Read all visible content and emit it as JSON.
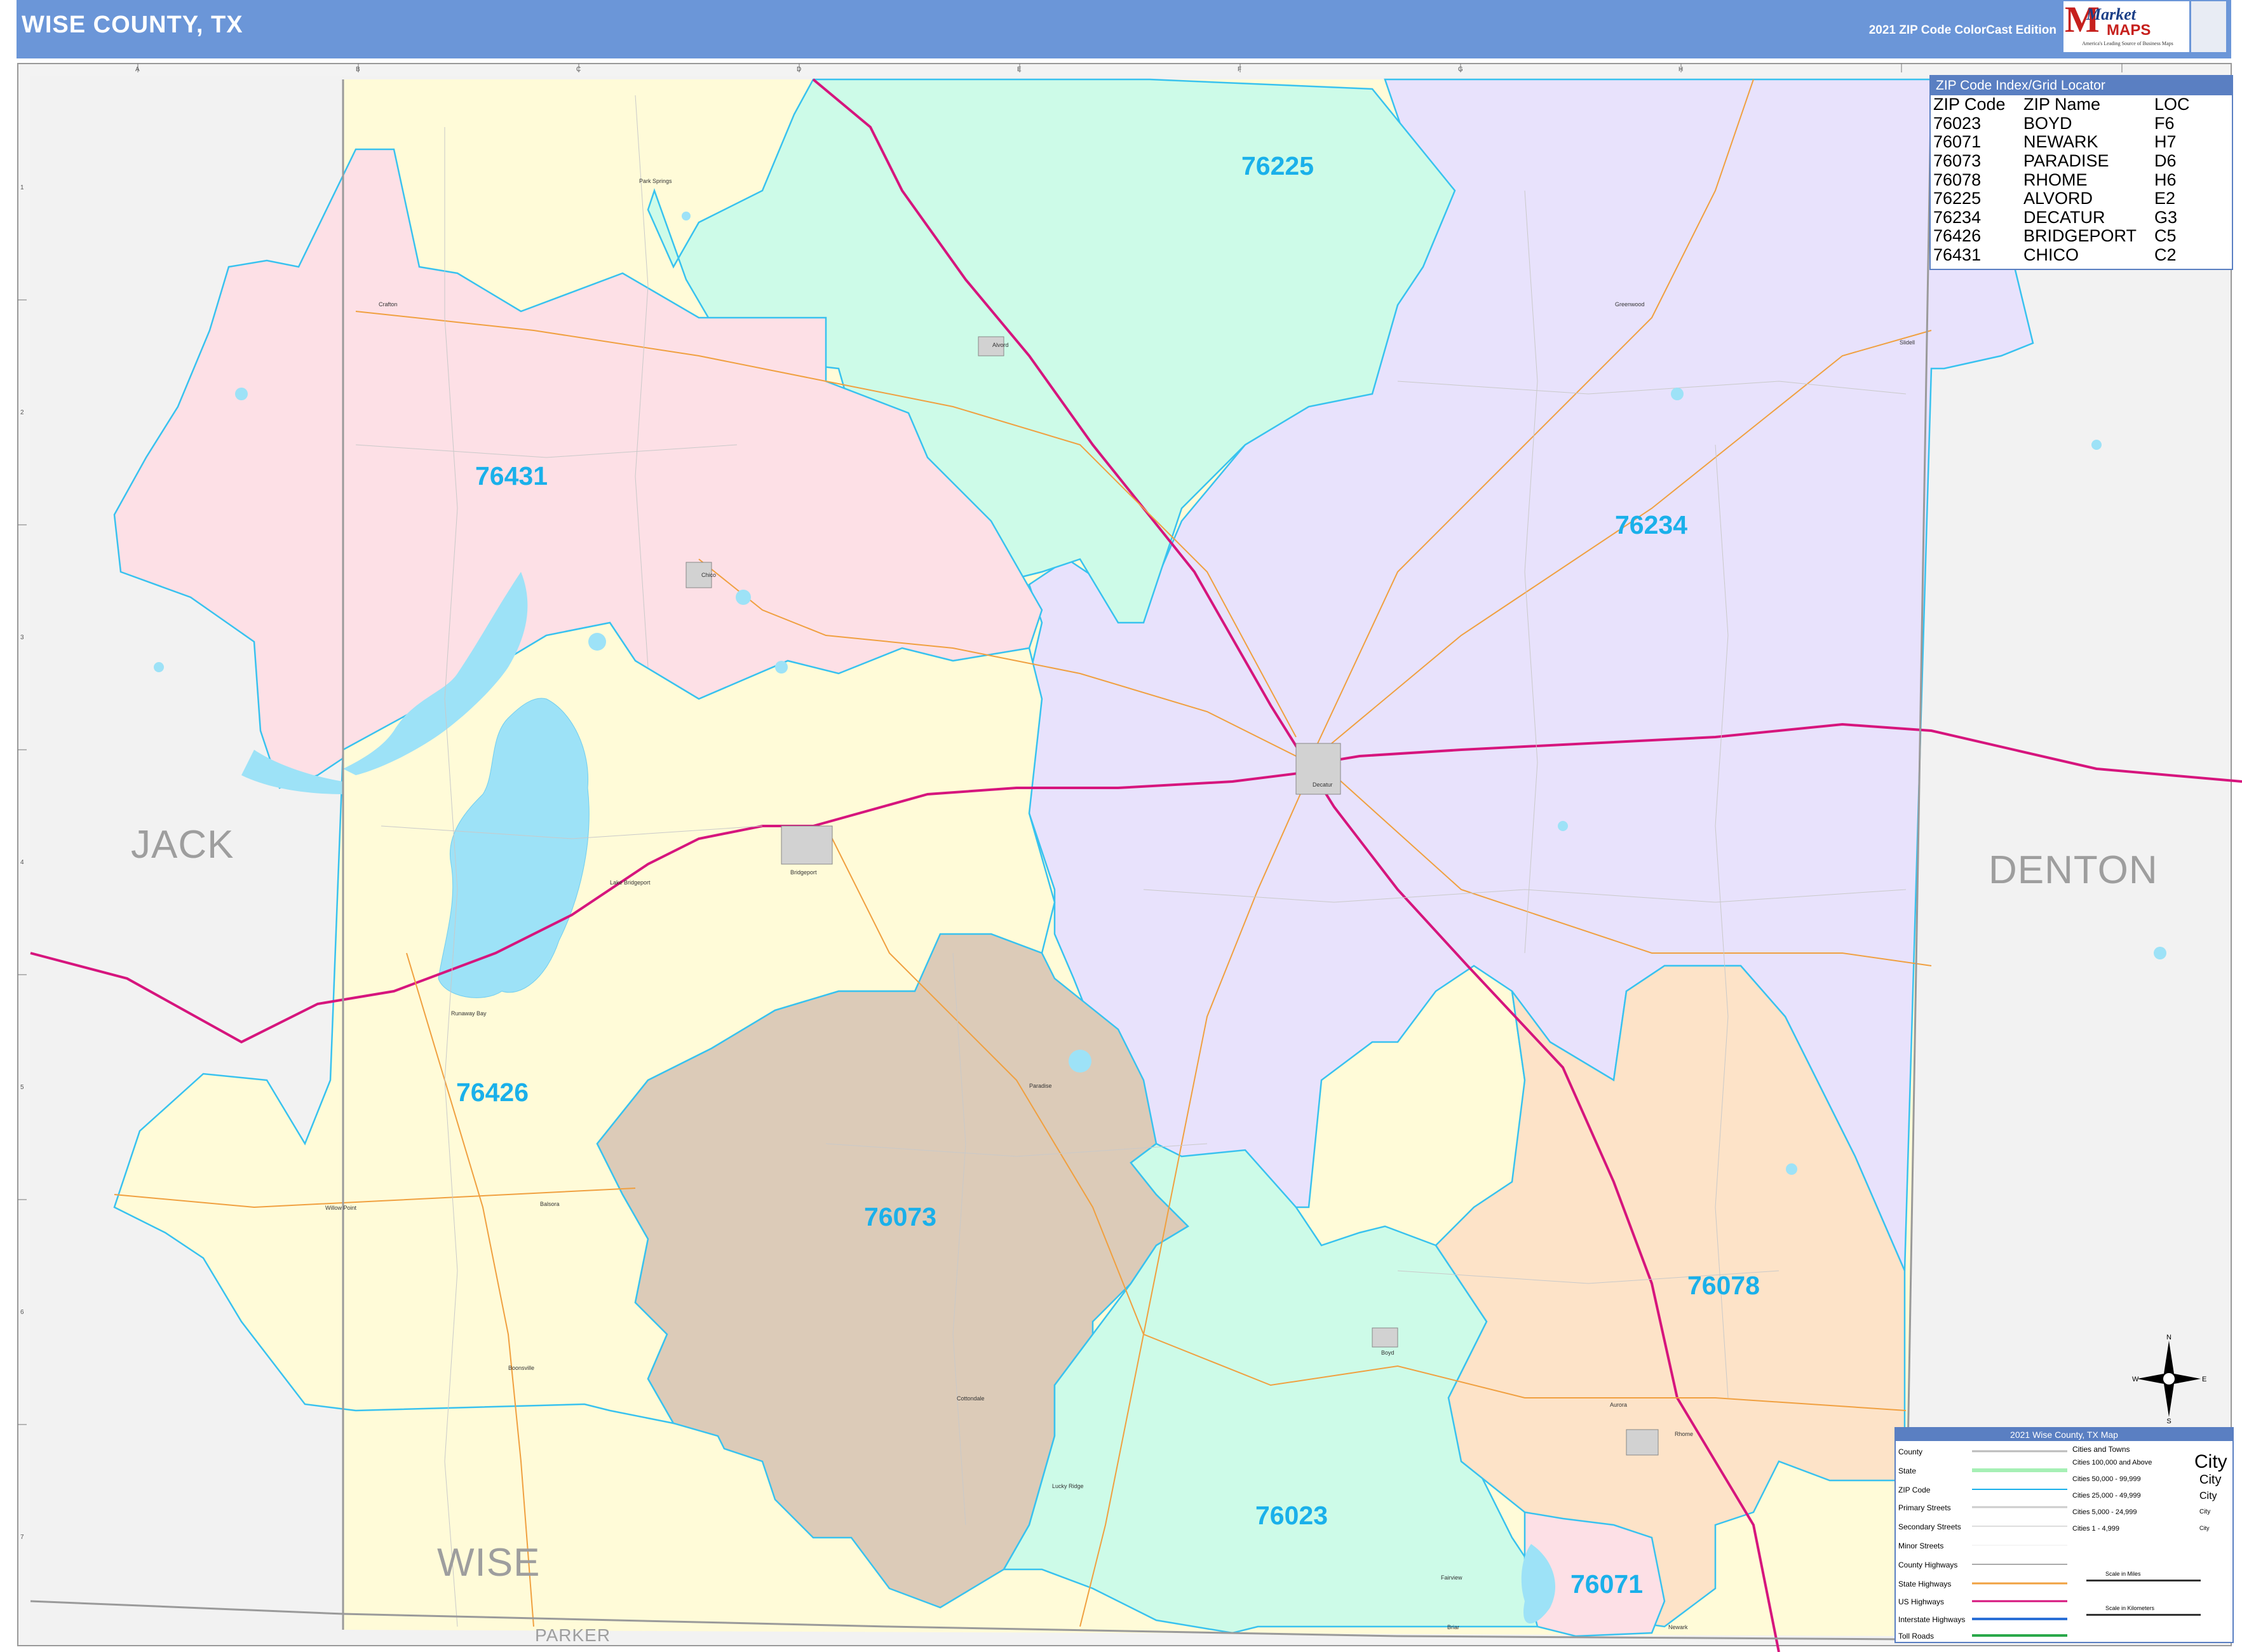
{
  "header": {
    "title": "WISE COUNTY, TX",
    "edition": "2021 ZIP Code ColorCast Edition",
    "logo_market": "Market",
    "logo_maps": "MAPS",
    "logo_tagline": "America's Leading Source of Business Maps"
  },
  "zip_index": {
    "title": "ZIP Code Index/Grid Locator",
    "headers": [
      "ZIP Code",
      "ZIP Name",
      "LOC"
    ],
    "rows": [
      [
        "76023",
        "BOYD",
        "F6"
      ],
      [
        "76071",
        "NEWARK",
        "H7"
      ],
      [
        "76073",
        "PARADISE",
        "D6"
      ],
      [
        "76078",
        "RHOME",
        "H6"
      ],
      [
        "76225",
        "ALVORD",
        "E2"
      ],
      [
        "76234",
        "DECATUR",
        "G3"
      ],
      [
        "76426",
        "BRIDGEPORT",
        "C5"
      ],
      [
        "76431",
        "CHICO",
        "C2"
      ]
    ]
  },
  "zip_areas": [
    {
      "zip": "76225",
      "color": "#cdfbe8"
    },
    {
      "zip": "76234",
      "color": "#e8e2fc"
    },
    {
      "zip": "76431",
      "color": "#fde0e6"
    },
    {
      "zip": "76426",
      "color": "#fffbd8"
    },
    {
      "zip": "76073",
      "color": "#dccbb8"
    },
    {
      "zip": "76023",
      "color": "#cdfbe8"
    },
    {
      "zip": "76078",
      "color": "#fde3c8"
    },
    {
      "zip": "76071",
      "color": "#fde0e6"
    }
  ],
  "counties": {
    "west": "JACK",
    "east": "DENTON",
    "center": "WISE",
    "south": "PARKER"
  },
  "places": [
    "Park Springs",
    "Greenwood",
    "Alvord",
    "Chico",
    "Decatur",
    "Bridgeport",
    "Lake Bridgeport",
    "Runaway Bay",
    "Paradise",
    "Willow Point",
    "Balsora",
    "Boonsville",
    "Cottondale",
    "Lucky Ridge",
    "Boyd",
    "Aurora",
    "Rhome",
    "Newark",
    "Briar",
    "Fairview",
    "Slidell",
    "Greenwood",
    "Crafton"
  ],
  "grid": {
    "columns": [
      "A",
      "B",
      "C",
      "D",
      "E",
      "F",
      "G",
      "H"
    ],
    "rows": [
      "1",
      "2",
      "3",
      "4",
      "5",
      "6",
      "7"
    ]
  },
  "legend": {
    "title": "2021 Wise County, TX Map",
    "items": [
      {
        "label": "County",
        "color": "#bbbbbb"
      },
      {
        "label": "State",
        "color": "#a6f0b5"
      },
      {
        "label": "ZIP Code",
        "color": "#1ab0ea"
      },
      {
        "label": "Primary Streets",
        "color": "#cccccc"
      },
      {
        "label": "Secondary Streets",
        "color": "#dddddd"
      },
      {
        "label": "Minor Streets",
        "color": "#eeeeee"
      },
      {
        "label": "County Highways",
        "color": "#aaaaaa"
      },
      {
        "label": "State Highways",
        "color": "#f0a040"
      },
      {
        "label": "US Highways",
        "color": "#d6157d"
      },
      {
        "label": "Interstate Highways",
        "color": "#2a6fd6"
      },
      {
        "label": "Toll Roads",
        "color": "#2aa84a"
      }
    ],
    "city_header": "Cities and Towns",
    "city_sizes": [
      {
        "label": "Cities 100,000 and Above",
        "sample": "City"
      },
      {
        "label": "Cities 50,000 - 99,999",
        "sample": "City"
      },
      {
        "label": "Cities 25,000 - 49,999",
        "sample": "City"
      },
      {
        "label": "Cities 5,000 - 24,999",
        "sample": "City"
      },
      {
        "label": "Cities 1 - 4,999",
        "sample": "City"
      }
    ],
    "scale_miles": "Scale in Miles",
    "scale_km": "Scale in Kilometers"
  },
  "compass": {
    "n": "N",
    "s": "S",
    "e": "E",
    "w": "W"
  }
}
